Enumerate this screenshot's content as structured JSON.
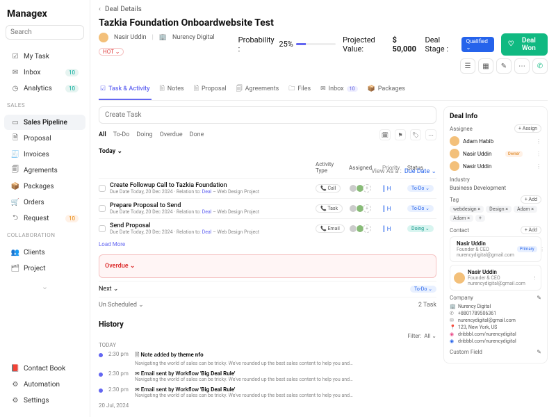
{
  "brand": "Managex",
  "search_placeholder": "Search",
  "nav": {
    "items": [
      {
        "label": "My Task",
        "icon": "☑"
      },
      {
        "label": "Inbox",
        "icon": "✉",
        "badge": "10"
      },
      {
        "label": "Analytics",
        "icon": "◷",
        "badge": "10"
      }
    ],
    "sales_label": "SALES",
    "sales": [
      {
        "label": "Sales Pipeline",
        "icon": "▭",
        "active": true
      },
      {
        "label": "Proposal",
        "icon": "🗎"
      },
      {
        "label": "Invoices",
        "icon": "🧾"
      },
      {
        "label": "Agrements",
        "icon": "🗐"
      },
      {
        "label": "Packages",
        "icon": "📦"
      },
      {
        "label": "Orders",
        "icon": "🛒"
      },
      {
        "label": "Request",
        "icon": "⮌",
        "badge": "10",
        "badge_orange": true
      }
    ],
    "collab_label": "COLLABORATION",
    "collab": [
      {
        "label": "Clients",
        "icon": "👥"
      },
      {
        "label": "Project",
        "icon": "🗂"
      }
    ],
    "bottom": [
      {
        "label": "Contact Book",
        "icon": "📕"
      },
      {
        "label": "Automation",
        "icon": "⚙"
      },
      {
        "label": "Settings",
        "icon": "⚙"
      }
    ]
  },
  "breadcrumb": {
    "back": "‹",
    "label": "Deal Details"
  },
  "deal": {
    "title": "Tazkia Foundation Onboardwebsite Test",
    "person": "Nasir Uddin",
    "org": "Nurency Digital",
    "hot": "HOT ⌄",
    "prob_label": "Probability :",
    "prob_value": "25%",
    "proj_label": "Projected Value:",
    "proj_value": "$ 50,000",
    "stage_label": "Deal Stage :",
    "stage_value": "Qualified ⌄",
    "won": "Deal Won"
  },
  "tabs": [
    {
      "label": "Task & Activity",
      "icon": "☑",
      "active": true
    },
    {
      "label": "Notes",
      "icon": "🗎"
    },
    {
      "label": "Proposal",
      "icon": "🗎"
    },
    {
      "label": "Agreements",
      "icon": "🗐"
    },
    {
      "label": "Files",
      "icon": "🗀"
    },
    {
      "label": "Inbox",
      "icon": "✉",
      "count": "10"
    },
    {
      "label": "Packages",
      "icon": "📦"
    }
  ],
  "create_task_placeholder": "Create Task",
  "filters": {
    "all": "All",
    "todo": "To-Do",
    "doing": "Doing",
    "overdue": "Overdue",
    "done": "Done"
  },
  "today_label": "Today ⌄",
  "th": {
    "activity": "Activity Type",
    "assigned": "Assigned",
    "priority": "Priority",
    "status": "Status"
  },
  "view_as": "View As a :",
  "view_val": "Due Date ⌄",
  "tasks": [
    {
      "title": "Create Followup Call to Tazkia Foundation",
      "sub": "Due Date Today, 20 Dec 2024 · Relation to: Deal – Web Design Project",
      "type": "Call",
      "pri": "H",
      "status": "To-Do ⌄",
      "status_cls": "todo"
    },
    {
      "title": "Prepare Proposal to Send",
      "sub": "Due Date Today, 20 Dec 2024 · Relation to: Deal – Web Design Project",
      "type": "Task",
      "pri": "H",
      "status": "To-Do ⌄",
      "status_cls": "todo"
    },
    {
      "title": "Send Proposal",
      "sub": "Due Date Today, 20 Dec 2024 · Relation to: Deal – Web Design Project",
      "type": "Email",
      "pri": "H",
      "status": "Doing ⌄",
      "status_cls": "doing"
    }
  ],
  "load_more": "Load More",
  "overdue_label": "Overdue ⌄",
  "next_label": "Next ⌄",
  "next_status": "To-Do ⌄",
  "unsched": {
    "label": "Un Scheduled ⌄",
    "count": "2 Task"
  },
  "history": {
    "title": "History",
    "today": "TODAY",
    "filter_label": "Filter:",
    "filter_val": "All ⌄",
    "date2": "20 Jul, 2024",
    "items": [
      {
        "time": "2:30 pm",
        "icon": "🗎",
        "title": "Note added by theme nfo",
        "sub": "Navigating the world of sales can be tricky. We've rounded up the best sales content to help you and…"
      },
      {
        "time": "2:30 pm",
        "icon": "✉",
        "title": "Email sent by Workflow 'Big Deal Rule'",
        "sub": "Navigating the world of sales can be tricky. We've rounded up the best sales content to help you and…"
      },
      {
        "time": "2:30 pm",
        "icon": "✉",
        "title": "Email sent by Workflow 'Big Deal Rule'",
        "sub": "Navigating the world of sales can be tricky. We've rounded up the best sales content to help you and…"
      }
    ]
  },
  "info": {
    "title": "Deal Info",
    "assignee_label": "Assignee",
    "assign_btn": "+ Assign",
    "assignees": [
      {
        "name": "Adam Habib"
      },
      {
        "name": "Nasir Uddin",
        "owner": true
      },
      {
        "name": "Nasir Uddin"
      }
    ],
    "owner_tag": "Owner",
    "industry_label": "Industry",
    "industry": "Business Development",
    "tag_label": "Tag",
    "add": "+ Add",
    "tags": [
      "webdesign ×",
      "Design ×",
      "Adam ×",
      "Adam ×",
      "+"
    ],
    "contact_label": "Contact",
    "contacts": [
      {
        "name": "Nasir Uddin",
        "role": "Founder & CEO",
        "email": "nurencydigital@gmail.com",
        "primary": true
      },
      {
        "name": "Nasir Uddin",
        "role": "Founder & CEO",
        "email": "nurencydigital@gmail.com"
      }
    ],
    "primary": "Primary",
    "company_label": "Company",
    "company": {
      "name": "Nurency Digital",
      "phone": "+8801789506361",
      "email": "nurencydigital@gmail.com",
      "addr": "123, New York, US",
      "web": "dribbbl.com/nurencydigital",
      "web2": "dribbbl.com/nurencydigital"
    },
    "custom_label": "Custom Field"
  }
}
